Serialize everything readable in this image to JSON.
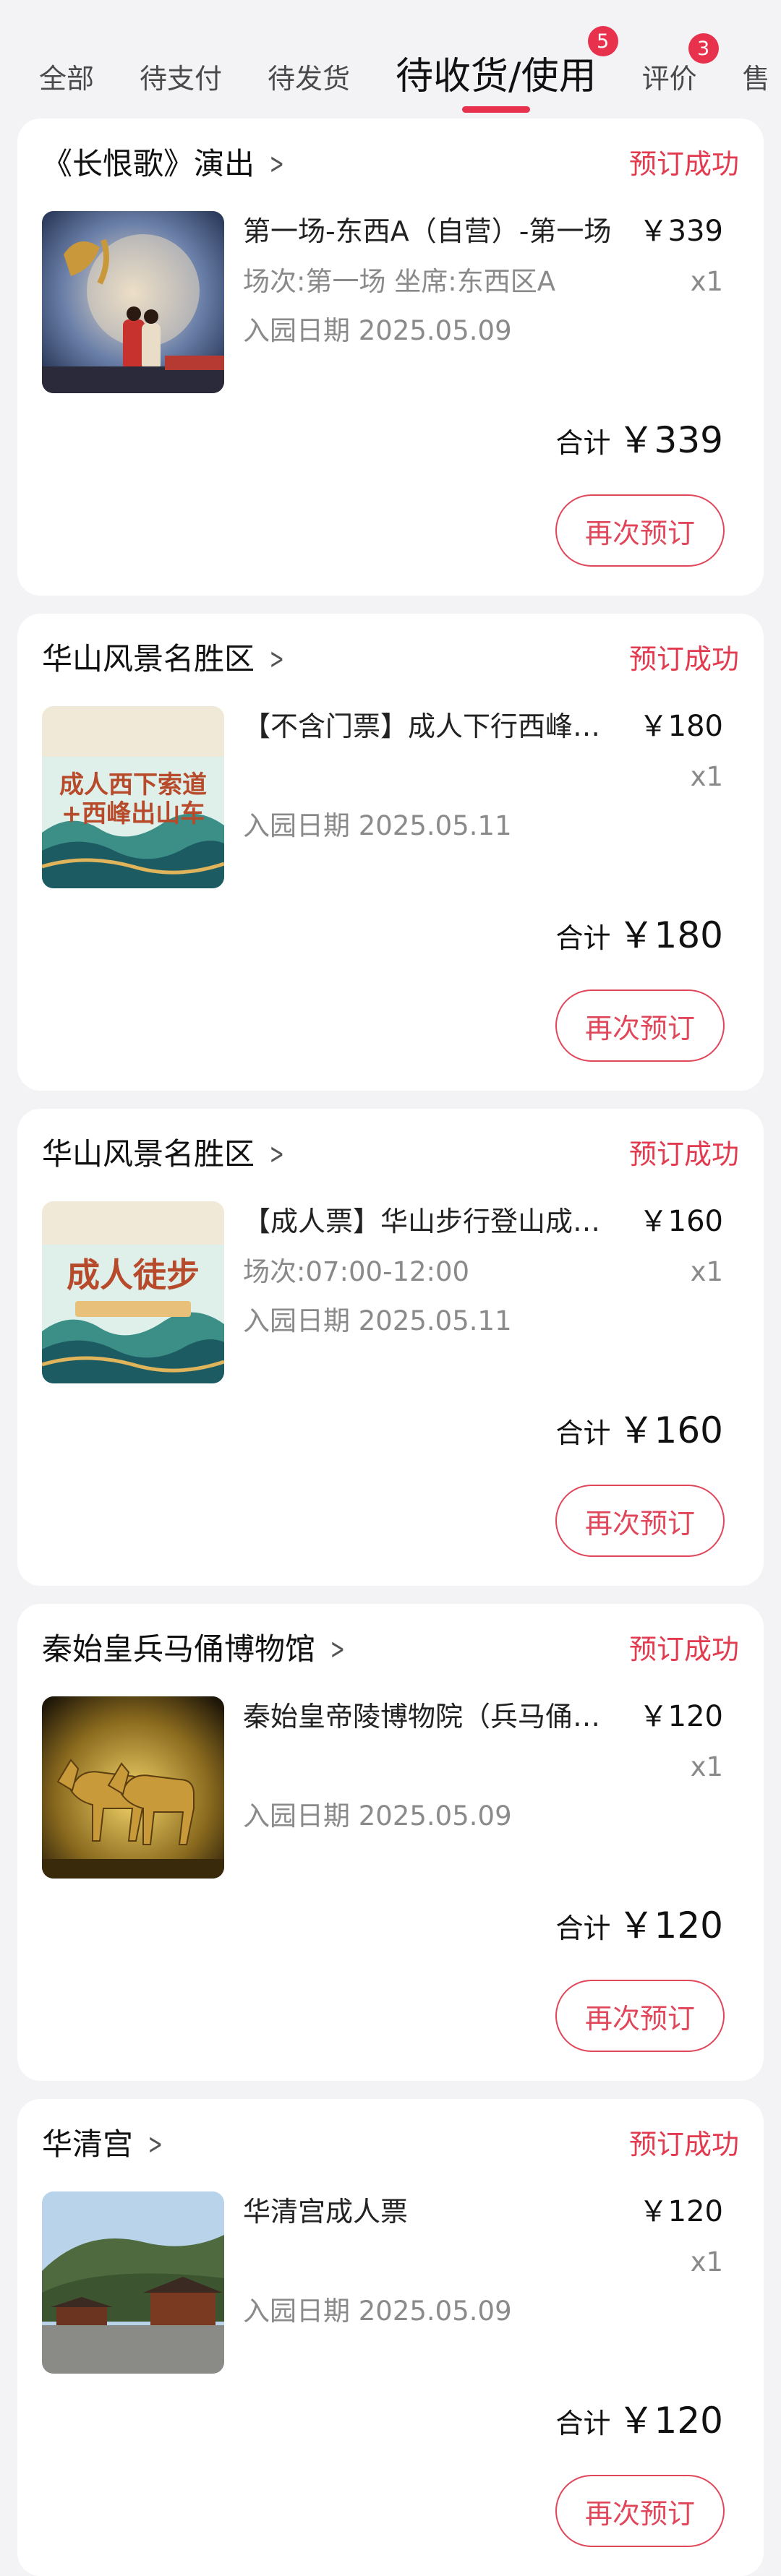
{
  "tabs": [
    {
      "label": "全部",
      "badge": ""
    },
    {
      "label": "待支付",
      "badge": ""
    },
    {
      "label": "待发货",
      "badge": ""
    },
    {
      "label": "待收货/使用",
      "badge": "5"
    },
    {
      "label": "评价",
      "badge": "3"
    },
    {
      "label": "售",
      "badge": ""
    }
  ],
  "orders": [
    {
      "shop": "《长恨歌》演出",
      "status": "预订成功",
      "item": "第一场-东西A（自营）-第一场",
      "price": "￥339",
      "session": "场次:第一场 坐席:东西区A",
      "qty": "x1",
      "date": "入园日期 2025.05.09",
      "total_label": "合计",
      "total": "￥339",
      "action": "再次预订",
      "thumb_icon": "performance-poster-icon"
    },
    {
      "shop": "华山风景名胜区",
      "status": "预订成功",
      "item": "【不含门票】成人下行西峰索道",
      "price": "￥180",
      "session": "",
      "qty": "x1",
      "date": "入园日期 2025.05.11",
      "total_label": "合计",
      "total": "￥180",
      "action": "再次预订",
      "thumb_icon": "cable-car-ticket-icon",
      "thumb_text_1": "成人西下索道",
      "thumb_text_2": "+西峰出山车"
    },
    {
      "shop": "华山风景名胜区",
      "status": "预订成功",
      "item": "【成人票】华山步行登山成人票",
      "price": "￥160",
      "session": "场次:07:00-12:00",
      "qty": "x1",
      "date": "入园日期 2025.05.11",
      "total_label": "合计",
      "total": "￥160",
      "action": "再次预订",
      "thumb_icon": "hiking-ticket-icon",
      "thumb_text_1": "成人徒步"
    },
    {
      "shop": "秦始皇兵马俑博物馆",
      "status": "预订成功",
      "item": "秦始皇帝陵博物院（兵马俑）门票",
      "price": "￥120",
      "session": "",
      "qty": "x1",
      "date": "入园日期 2025.05.09",
      "total_label": "合计",
      "total": "￥120",
      "action": "再次预订",
      "thumb_icon": "terracotta-horses-icon"
    },
    {
      "shop": "华清宫",
      "status": "预订成功",
      "item": "华清宫成人票",
      "price": "￥120",
      "session": "",
      "qty": "x1",
      "date": "入园日期 2025.05.09",
      "total_label": "合计",
      "total": "￥120",
      "action": "再次预订",
      "thumb_icon": "palace-landscape-icon"
    }
  ],
  "colors": {
    "accent": "#e8314d",
    "background": "#f3f3f6",
    "card": "#ffffff"
  }
}
